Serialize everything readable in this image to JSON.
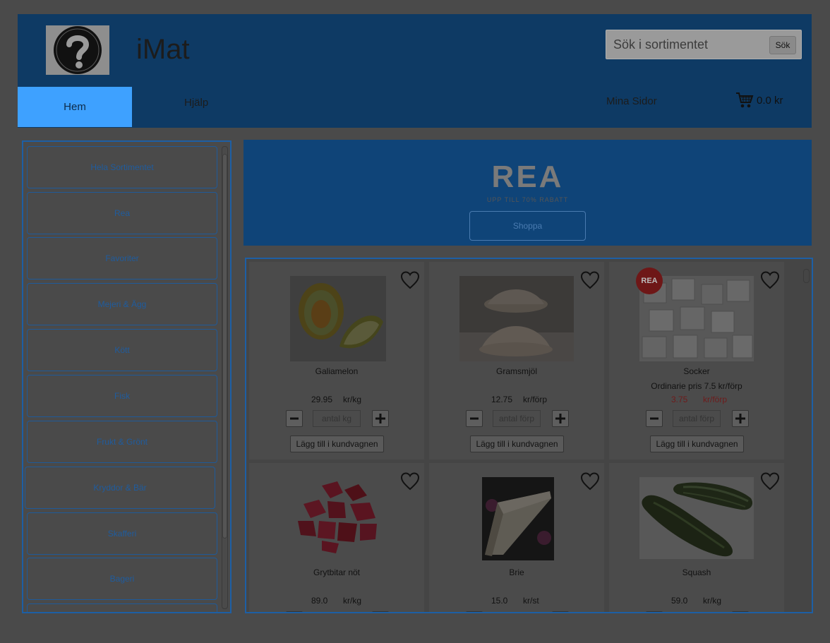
{
  "header": {
    "app_title": "iMat",
    "logo_icon": "question-mark-icon",
    "search": {
      "placeholder": "Sök i sortimentet",
      "button_label": "Sök"
    },
    "nav": {
      "home": "Hem",
      "help": "Hjälp",
      "my_pages": "Mina Sidor"
    },
    "cart": {
      "icon": "shopping-cart-icon",
      "total": "0.0 kr"
    }
  },
  "sidebar": {
    "categories": [
      "Hela Sortimentet",
      "Rea",
      "Favoriter",
      "Mejeri & Ägg",
      "Kött",
      "Fisk",
      "Frukt & Grönt",
      "Kryddor & Bär",
      "Skafferi",
      "Bageri"
    ]
  },
  "banner": {
    "title": "REA",
    "subtitle": "UPP TILL 70% RABATT",
    "button_label": "Shoppa"
  },
  "products": [
    {
      "name": "Galiamelon",
      "price": "29.95",
      "unit": "kr/kg",
      "qty_placeholder": "antal kg",
      "add_label": "Lägg till i kundvagnen",
      "sale": false
    },
    {
      "name": "Gramsmjöl",
      "price": "12.75",
      "unit": "kr/förp",
      "qty_placeholder": "antal förp",
      "add_label": "Lägg till i kundvagnen",
      "sale": false
    },
    {
      "name": "Socker",
      "ordinary_price": "Ordinarie pris 7.5 kr/förp",
      "price": "3.75",
      "unit": "kr/förp",
      "qty_placeholder": "antal förp",
      "add_label": "Lägg till i kundvagnen",
      "sale": true,
      "badge": "REA"
    },
    {
      "name": "Grytbitar nöt",
      "price": "89.0",
      "unit": "kr/kg",
      "sale": false
    },
    {
      "name": "Brie",
      "price": "15.0",
      "unit": "kr/st",
      "sale": false
    },
    {
      "name": "Squash",
      "price": "59.0",
      "unit": "kr/kg",
      "sale": false
    }
  ],
  "colors": {
    "header_bg": "#0e3a64",
    "active_tab": "#3ea1ff",
    "accent_border": "#1d5fa5",
    "sale_price": "#6e1b1b"
  }
}
